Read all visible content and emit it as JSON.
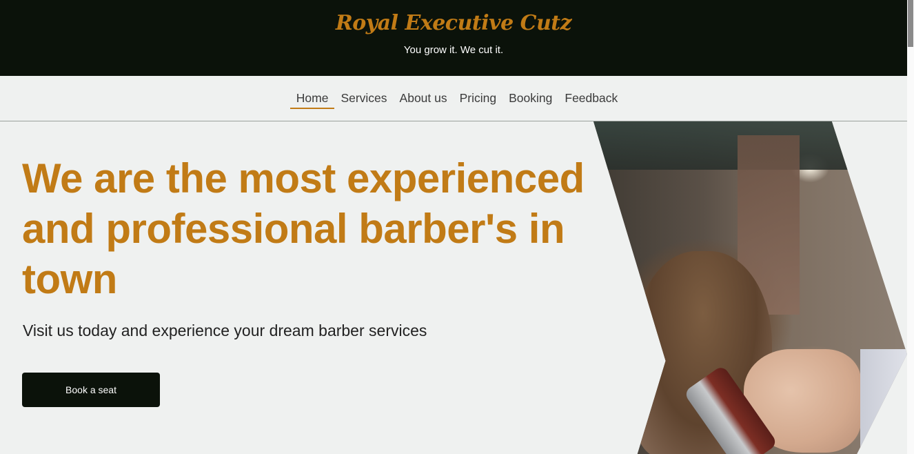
{
  "header": {
    "brand": "Royal Executive Cutz",
    "tagline": "You grow it. We cut it."
  },
  "nav": {
    "items": [
      {
        "label": "Home",
        "active": true
      },
      {
        "label": "Services",
        "active": false
      },
      {
        "label": "About us",
        "active": false
      },
      {
        "label": "Pricing",
        "active": false
      },
      {
        "label": "Booking",
        "active": false
      },
      {
        "label": "Feedback",
        "active": false
      }
    ]
  },
  "hero": {
    "title": "We are the most experienced and professional barber's in town",
    "subtitle": "Visit us today and experience your dream barber services",
    "cta_label": "Book a seat"
  },
  "colors": {
    "accent": "#c17b16",
    "dark": "#0b120a",
    "background": "#eff1f0"
  }
}
